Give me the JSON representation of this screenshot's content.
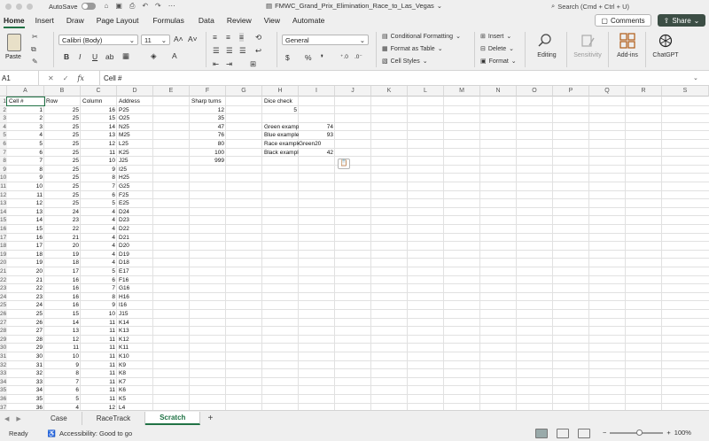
{
  "titlebar": {
    "autosave_label": "AutoSave",
    "doc_title": "FMWC_Grand_Prix_Elimination_Race_to_Las_Vegas",
    "search_placeholder": "Search (Cmd + Ctrl + U)"
  },
  "ribbon_tabs": [
    "Home",
    "Insert",
    "Draw",
    "Page Layout",
    "Formulas",
    "Data",
    "Review",
    "View",
    "Automate"
  ],
  "ribbon_actions": {
    "comments_label": "Comments",
    "share_label": "Share"
  },
  "ribbon": {
    "paste_label": "Paste",
    "font_name": "Calibri (Body)",
    "font_size": "11",
    "number_format": "General",
    "conditional_formatting": "Conditional Formatting",
    "format_as_table": "Format as Table",
    "cell_styles": "Cell Styles",
    "insert": "Insert",
    "delete": "Delete",
    "format": "Format",
    "editing": "Editing",
    "sensitivity": "Sensitivity",
    "addins": "Add-ins",
    "chatgpt": "ChatGPT"
  },
  "formula_bar": {
    "name_box": "A1",
    "formula": "Cell #"
  },
  "columns": [
    "A",
    "B",
    "C",
    "D",
    "E",
    "F",
    "G",
    "H",
    "I",
    "J",
    "K",
    "L",
    "M",
    "N",
    "O",
    "P",
    "Q",
    "R",
    "S"
  ],
  "rows": [
    "1",
    "2",
    "3",
    "4",
    "5",
    "6",
    "7",
    "8",
    "9",
    "10",
    "11",
    "12",
    "13",
    "14",
    "15",
    "16",
    "17",
    "18",
    "19",
    "20",
    "21",
    "22",
    "23",
    "24",
    "25",
    "26",
    "27",
    "28",
    "29",
    "30",
    "31",
    "32",
    "33",
    "34",
    "35",
    "36",
    "37"
  ],
  "headers": {
    "a": "Cell #",
    "b": "Row",
    "c": "Column",
    "d": "Address",
    "f": "Sharp turns",
    "h": "Dice check"
  },
  "table_rows": [
    [
      "1",
      "25",
      "16",
      "P25"
    ],
    [
      "2",
      "25",
      "15",
      "O25"
    ],
    [
      "3",
      "25",
      "14",
      "N25"
    ],
    [
      "4",
      "25",
      "13",
      "M25"
    ],
    [
      "5",
      "25",
      "12",
      "L25"
    ],
    [
      "6",
      "25",
      "11",
      "K25"
    ],
    [
      "7",
      "25",
      "10",
      "J25"
    ],
    [
      "8",
      "25",
      "9",
      "I25"
    ],
    [
      "9",
      "25",
      "8",
      "H25"
    ],
    [
      "10",
      "25",
      "7",
      "G25"
    ],
    [
      "11",
      "25",
      "6",
      "F25"
    ],
    [
      "12",
      "25",
      "5",
      "E25"
    ],
    [
      "13",
      "24",
      "4",
      "D24"
    ],
    [
      "14",
      "23",
      "4",
      "D23"
    ],
    [
      "15",
      "22",
      "4",
      "D22"
    ],
    [
      "16",
      "21",
      "4",
      "D21"
    ],
    [
      "17",
      "20",
      "4",
      "D20"
    ],
    [
      "18",
      "19",
      "4",
      "D19"
    ],
    [
      "19",
      "18",
      "4",
      "D18"
    ],
    [
      "20",
      "17",
      "5",
      "E17"
    ],
    [
      "21",
      "16",
      "6",
      "F16"
    ],
    [
      "22",
      "16",
      "7",
      "G16"
    ],
    [
      "23",
      "16",
      "8",
      "H16"
    ],
    [
      "24",
      "16",
      "9",
      "I16"
    ],
    [
      "25",
      "15",
      "10",
      "J15"
    ],
    [
      "26",
      "14",
      "11",
      "K14"
    ],
    [
      "27",
      "13",
      "11",
      "K13"
    ],
    [
      "28",
      "12",
      "11",
      "K12"
    ],
    [
      "29",
      "11",
      "11",
      "K11"
    ],
    [
      "30",
      "10",
      "11",
      "K10"
    ],
    [
      "31",
      "9",
      "11",
      "K9"
    ],
    [
      "32",
      "8",
      "11",
      "K8"
    ],
    [
      "33",
      "7",
      "11",
      "K7"
    ],
    [
      "34",
      "6",
      "11",
      "K6"
    ],
    [
      "35",
      "5",
      "11",
      "K5"
    ],
    [
      "36",
      "4",
      "12",
      "L4"
    ]
  ],
  "sharp_turns": [
    "12",
    "35",
    "47",
    "76",
    "80",
    "100",
    "999"
  ],
  "dice_check_value": "5",
  "examples": [
    {
      "label": "Green example",
      "value": "74"
    },
    {
      "label": "Blue example",
      "value": "93"
    },
    {
      "label": "Race example",
      "value": "Green20"
    },
    {
      "label": "Black example",
      "value": "42"
    }
  ],
  "sheets": [
    "Case",
    "RaceTrack",
    "Scratch"
  ],
  "active_sheet": "Scratch",
  "status": {
    "ready": "Ready",
    "accessibility": "Accessibility: Good to go",
    "zoom": "100%"
  }
}
